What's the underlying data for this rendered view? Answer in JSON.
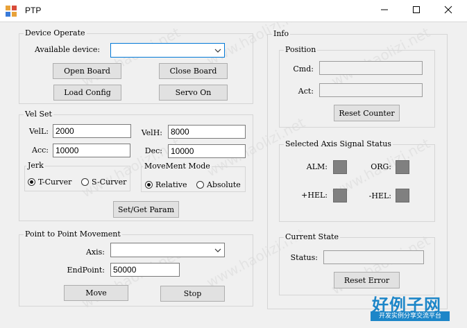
{
  "window": {
    "title": "PTP",
    "minimize_icon": "minimize-icon",
    "maximize_icon": "maximize-icon",
    "close_icon": "close-icon"
  },
  "device_operate": {
    "legend": "Device Operate",
    "available_device_label": "Available device:",
    "available_device_value": "",
    "open_board": "Open Board",
    "close_board": "Close Board",
    "load_config": "Load Config",
    "servo_on": "Servo On"
  },
  "vel_set": {
    "legend": "Vel Set",
    "vell_label": "VelL:",
    "vell_value": "2000",
    "velh_label": "VelH:",
    "velh_value": "8000",
    "acc_label": "Acc:",
    "acc_value": "10000",
    "dec_label": "Dec:",
    "dec_value": "10000",
    "jerk": {
      "legend": "Jerk",
      "options": [
        "T-Curver",
        "S-Curver"
      ],
      "selected": "T-Curver"
    },
    "movement_mode": {
      "legend": "MoveMent Mode",
      "options": [
        "Relative",
        "Absolute"
      ],
      "selected": "Relative"
    },
    "set_get_param": "Set/Get Param"
  },
  "ptp": {
    "legend": "Point to Point Movement",
    "axis_label": "Axis:",
    "axis_value": "",
    "endpoint_label": "EndPoint:",
    "endpoint_value": "50000",
    "move": "Move",
    "stop": "Stop"
  },
  "info": {
    "legend": "Info",
    "position": {
      "legend": "Position",
      "cmd_label": "Cmd:",
      "cmd_value": "",
      "act_label": "Act:",
      "act_value": "",
      "reset_counter": "Reset Counter"
    },
    "signal_status": {
      "legend": "Selected Axis Signal Status",
      "alm_label": "ALM:",
      "org_label": "ORG:",
      "phel_label": "+HEL:",
      "mhel_label": "-HEL:",
      "led_color": "#808080"
    },
    "current_state": {
      "legend": "Current State",
      "status_label": "Status:",
      "status_value": "",
      "reset_error": "Reset Error"
    }
  },
  "watermark": {
    "text": "www.haolizi.net",
    "brand_title": "好例子网",
    "brand_subtitle": "开发实例分享交流平台",
    "brand_color": "#1d86c8"
  }
}
